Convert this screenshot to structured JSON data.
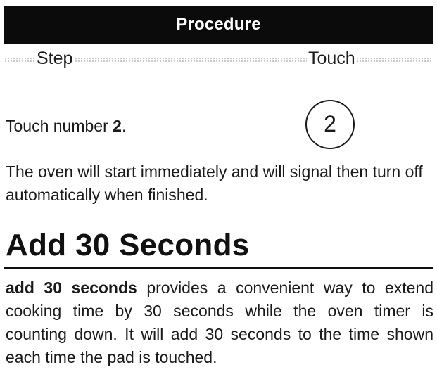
{
  "procedure": {
    "header": "Procedure",
    "col_step": "Step",
    "col_touch": "Touch"
  },
  "step": {
    "text_before": "Touch number ",
    "number_bold": "2",
    "text_after": ".",
    "touch_key": "2"
  },
  "paragraph_1": "The oven will start immediately and will signal then turn off automatically when finished.",
  "section": {
    "title": "Add 30 Seconds",
    "lead_bold": "add 30 seconds",
    "body": " provides a convenient way to extend cooking time by 30 seconds while the oven timer is counting down. It will add 30 seconds to the time shown each time the pad is touched."
  }
}
